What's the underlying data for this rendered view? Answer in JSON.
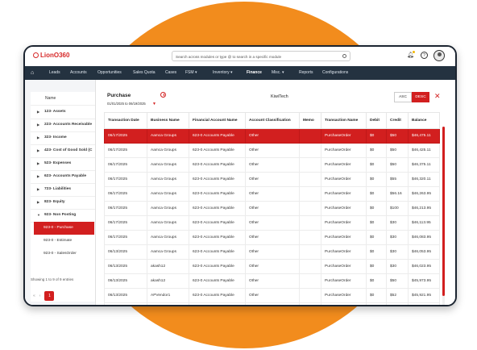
{
  "app": {
    "logo_text": "LionO360"
  },
  "search": {
    "placeholder": "Search across modules or type @ to search in a specific module"
  },
  "nav": {
    "items": [
      {
        "label": "Leads"
      },
      {
        "label": "Accounts"
      },
      {
        "label": "Opportunities"
      },
      {
        "label": "Sales Quota"
      },
      {
        "label": "Cases"
      },
      {
        "label": "FSM ▾"
      },
      {
        "label": "Inventory ▾"
      },
      {
        "label": "Finance"
      },
      {
        "label": "Misc. ▾"
      },
      {
        "label": "Reports"
      },
      {
        "label": "Configurations"
      }
    ]
  },
  "sidebar": {
    "header": "Name",
    "tree": [
      {
        "label": "123- Assets",
        "arrow": "▶"
      },
      {
        "label": "223- Accounts Receivable",
        "arrow": "▶"
      },
      {
        "label": "323- Income",
        "arrow": "▶"
      },
      {
        "label": "423- Cost of Good Sold (C",
        "arrow": "▶"
      },
      {
        "label": "523- Expenses",
        "arrow": "▶"
      },
      {
        "label": "623- Accounts Payable",
        "arrow": "▶"
      },
      {
        "label": "723- Liabilities",
        "arrow": "▶"
      },
      {
        "label": "823- Equity",
        "arrow": "▶"
      },
      {
        "label": "923- Non Posting",
        "arrow": "▼"
      }
    ],
    "sub_items": [
      {
        "label": "923-0 - Purchase"
      },
      {
        "label": "923-0 - Estimate"
      },
      {
        "label": "923-0 - SalesOrder"
      }
    ],
    "showing": "Showing 1 to 9 of 9 entries",
    "pager": {
      "first": "«",
      "prev": "‹",
      "page": "1"
    }
  },
  "main": {
    "title": "Purchase",
    "date_range": "01/01/2025 to 06/19/2025",
    "caret": "▼",
    "company": "KiwiTech",
    "asc_label": "ASC",
    "desc_label": "DESC",
    "close": "✕"
  },
  "table": {
    "columns": [
      "Transaction Date",
      "Business Name",
      "Financial Account Name",
      "Account Classification",
      "Memo",
      "Transaction Name",
      "Debit",
      "Credit",
      "Balance"
    ],
    "rows": [
      [
        "06/17/2025",
        "Aamca Groups",
        "623-0 Accounts Payable",
        "Other",
        "",
        "PurchaseOrder",
        "$0",
        "$50",
        "$46,475.11"
      ],
      [
        "06/17/2025",
        "Aamca Groups",
        "623-0 Accounts Payable",
        "Other",
        "",
        "PurchaseOrder",
        "$0",
        "$50",
        "$46,425.11"
      ],
      [
        "06/17/2025",
        "Aamca Groups",
        "623-0 Accounts Payable",
        "Other",
        "",
        "PurchaseOrder",
        "$0",
        "$50",
        "$46,375.11"
      ],
      [
        "06/17/2025",
        "Aamca Groups",
        "623-0 Accounts Payable",
        "Other",
        "",
        "PurchaseOrder",
        "$0",
        "$55",
        "$46,320.11"
      ],
      [
        "06/17/2025",
        "Aamca Groups",
        "623-0 Accounts Payable",
        "Other",
        "",
        "PurchaseOrder",
        "$0",
        "$56.16",
        "$46,263.95"
      ],
      [
        "06/17/2025",
        "Aamca Groups",
        "623-0 Accounts Payable",
        "Other",
        "",
        "PurchaseOrder",
        "$0",
        "$100",
        "$46,213.95"
      ],
      [
        "06/17/2025",
        "Aamca Groups",
        "623-0 Accounts Payable",
        "Other",
        "",
        "PurchaseOrder",
        "$0",
        "$30",
        "$46,113.95"
      ],
      [
        "06/17/2025",
        "Aamca Groups",
        "623-0 Accounts Payable",
        "Other",
        "",
        "PurchaseOrder",
        "$0",
        "$30",
        "$46,083.95"
      ],
      [
        "06/13/2025",
        "Aamca Groups",
        "623-0 Accounts Payable",
        "Other",
        "",
        "PurchaseOrder",
        "$0",
        "$30",
        "$46,053.95"
      ],
      [
        "06/13/2025",
        "akash12",
        "623-0 Accounts Payable",
        "Other",
        "",
        "PurchaseOrder",
        "$0",
        "$30",
        "$46,023.95"
      ],
      [
        "06/13/2025",
        "akash12",
        "623-0 Accounts Payable",
        "Other",
        "",
        "PurchaseOrder",
        "$0",
        "$50",
        "$45,973.95"
      ],
      [
        "06/13/2025",
        "APVendor1",
        "623-0 Accounts Payable",
        "Other",
        "",
        "PurchaseOrder",
        "$0",
        "$52",
        "$45,921.95"
      ],
      [
        "06/11/2025",
        "APVendor1",
        "623-0 Accounts Payable",
        "Other",
        "",
        "PurchaseOrder",
        "$0",
        "$114",
        "$45,871.95"
      ]
    ]
  },
  "colors": {
    "accent": "#d21f1f",
    "nav_bg": "#243240",
    "circle": "#f28c1d"
  }
}
